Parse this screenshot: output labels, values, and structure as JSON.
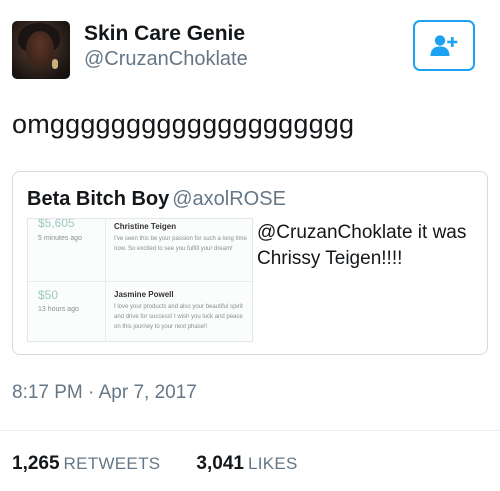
{
  "user": {
    "display_name": "Skin Care Genie",
    "handle": "@CruzanChoklate"
  },
  "follow_button": {
    "icon": "add-user-icon",
    "color": "#1da1f2"
  },
  "tweet": {
    "text": "omgggggggggggggggggggg",
    "timestamp": "8:17 PM · Apr 7, 2017"
  },
  "quote": {
    "author_name": "Beta Bitch Boy",
    "author_handle": "@axolROSE",
    "text": "@CruzanChoklate it was Chrissy Teigen!!!!",
    "image": {
      "donations": [
        {
          "amount": "$5,605",
          "time": "5 minutes ago",
          "name": "Christine Teigen",
          "message": "I've seen this be your passion for such a long time now. So excited to see you fulfill your dream!"
        },
        {
          "amount": "$50",
          "time": "13 hours ago",
          "name": "Jasmine Powell",
          "message": "I love your products and also your beautiful spirit and drive for success! I wish you luck and peace on this journey to your next phase!!"
        }
      ]
    }
  },
  "stats": {
    "retweets_count": "1,265",
    "retweets_label": "RETWEETS",
    "likes_count": "3,041",
    "likes_label": "LIKES"
  }
}
